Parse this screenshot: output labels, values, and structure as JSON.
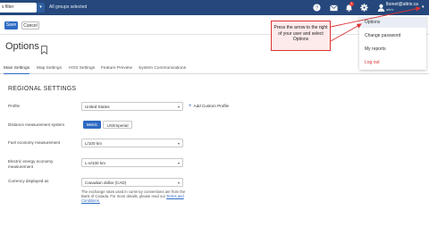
{
  "topbar": {
    "filter_text": "s filter",
    "groups_text": "All groups selected",
    "notification_count": "1",
    "user_email": "lbonet@altrix.ca",
    "user_org": "altrix",
    "colors": {
      "bar": "#25477b",
      "badge": "#e53935"
    },
    "icons": [
      "help-icon",
      "mail-icon",
      "bell-icon",
      "gear-icon",
      "user-icon"
    ]
  },
  "toolbar": {
    "save_label": "Save",
    "cancel_label": "Cancel"
  },
  "page": {
    "title": "Options"
  },
  "tabs": [
    {
      "label": "Main Settings",
      "active": true
    },
    {
      "label": "Map Settings",
      "active": false
    },
    {
      "label": "HOS Settings",
      "active": false
    },
    {
      "label": "Feature Preview",
      "active": false
    },
    {
      "label": "System Communications",
      "active": false
    }
  ],
  "regional": {
    "section_title": "REGIONAL SETTINGS",
    "profile_label": "Profile",
    "profile_value": "United States",
    "add_custom_label": "Add Custom Profile",
    "distance_label": "Distance measurement system",
    "metric_label": "Metric",
    "imperial_label": "US/Imperial",
    "fuel_label": "Fuel economy measurement",
    "fuel_value": "L/100 km",
    "electric_label": "Electric energy economy measurement",
    "electric_value": "L-e/100 km",
    "currency_label": "Currency displayed as",
    "currency_value": "Canadian dollar (CAD)",
    "note_text": "The exchange rates used in currency conversions are from the Bank of Canada. For more details, please read our",
    "note_link": "Terms and Conditions."
  },
  "callout": {
    "text": "Press the arrow to the right of your user and select Options"
  },
  "menu": {
    "items": [
      {
        "label": "Options",
        "highlighted": true
      },
      {
        "label": "Change password",
        "highlighted": false
      },
      {
        "label": "My reports",
        "highlighted": false
      },
      {
        "label": "Log out",
        "highlighted": false
      }
    ],
    "colors": {
      "logout": "#d0342c",
      "highlight": "#e9eef6"
    }
  },
  "colors": {
    "primary": "#2e6ac3",
    "callout_border": "#dd3333"
  }
}
